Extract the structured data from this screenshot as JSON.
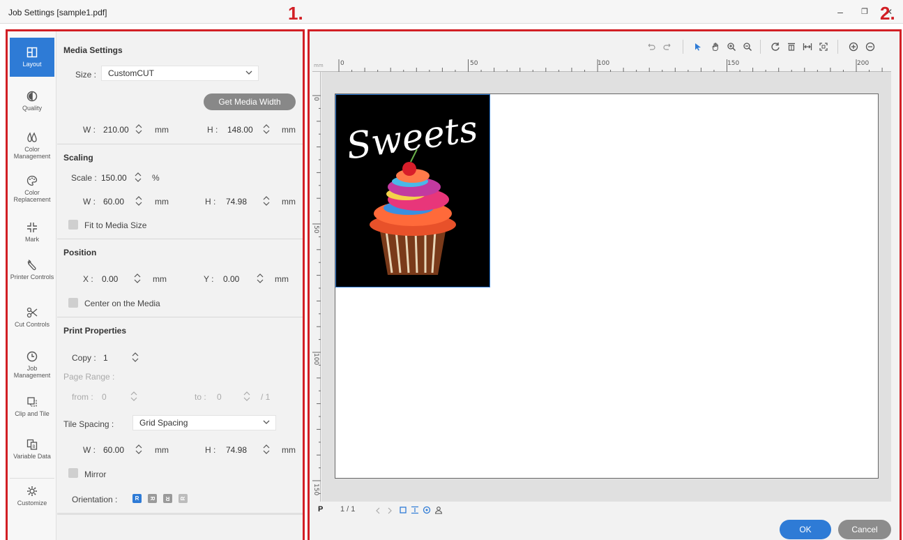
{
  "window": {
    "title": "Job Settings [sample1.pdf]",
    "minimize": "–",
    "restore": "❐",
    "close": "✕"
  },
  "callouts": {
    "one": "1.",
    "two": "2."
  },
  "sidebar": {
    "items": [
      {
        "label": "Layout",
        "icon": "layout-icon"
      },
      {
        "label": "Quality",
        "icon": "quality-icon"
      },
      {
        "label": "Color Management",
        "icon": "color-management-icon"
      },
      {
        "label": "Color Replacement",
        "icon": "palette-icon"
      },
      {
        "label": "Mark",
        "icon": "mark-icon"
      },
      {
        "label": "Printer Controls",
        "icon": "wrench-icon"
      },
      {
        "label": "Cut Controls",
        "icon": "scissors-icon"
      },
      {
        "label": "Job Management",
        "icon": "clock-icon"
      },
      {
        "label": "Clip and Tile",
        "icon": "clip-tile-icon"
      },
      {
        "label": "Variable Data",
        "icon": "variable-data-icon"
      },
      {
        "label": "Customize",
        "icon": "gear-icon"
      }
    ]
  },
  "media_settings": {
    "title": "Media Settings",
    "size_label": "Size :",
    "size_value": "CustomCUT",
    "get_width_button": "Get Media Width",
    "w_label": "W :",
    "w_value": "210.00",
    "h_label": "H :",
    "h_value": "148.00",
    "unit": "mm"
  },
  "scaling": {
    "title": "Scaling",
    "scale_label": "Scale :",
    "scale_value": "150.00",
    "scale_unit": "%",
    "w_label": "W :",
    "w_value": "60.00",
    "h_label": "H :",
    "h_value": "74.98",
    "unit": "mm",
    "fit_label": "Fit to Media Size"
  },
  "position": {
    "title": "Position",
    "x_label": "X :",
    "x_value": "0.00",
    "y_label": "Y :",
    "y_value": "0.00",
    "unit": "mm",
    "center_label": "Center on the Media"
  },
  "print_properties": {
    "title": "Print Properties",
    "copy_label": "Copy :",
    "copy_value": "1",
    "page_range_label": "Page Range :",
    "from_label": "from :",
    "from_value": "0",
    "to_label": "to :",
    "to_value": "0",
    "of_total": "/ 1",
    "tile_spacing_label": "Tile Spacing :",
    "tile_spacing_value": "Grid Spacing",
    "w_label": "W :",
    "w_value": "60.00",
    "h_label": "H :",
    "h_value": "74.98",
    "unit": "mm",
    "mirror_label": "Mirror",
    "orientation_label": "Orientation :",
    "orientation_glyphs": [
      "R",
      "R",
      "R",
      "R"
    ]
  },
  "preview": {
    "ruler_unit": "mm",
    "top_ruler_labels": [
      "0",
      "50",
      "100",
      "150",
      "200"
    ],
    "left_ruler_labels": [
      "0",
      "50",
      "100",
      "150"
    ],
    "artwork_text": "Sweets",
    "page_indicator_prefix": "P",
    "page_indicator": "1 / 1"
  },
  "buttons": {
    "ok": "OK",
    "cancel": "Cancel"
  },
  "colors": {
    "accent": "#2e7bd6",
    "callout": "#d21f25",
    "pill": "#888888"
  }
}
